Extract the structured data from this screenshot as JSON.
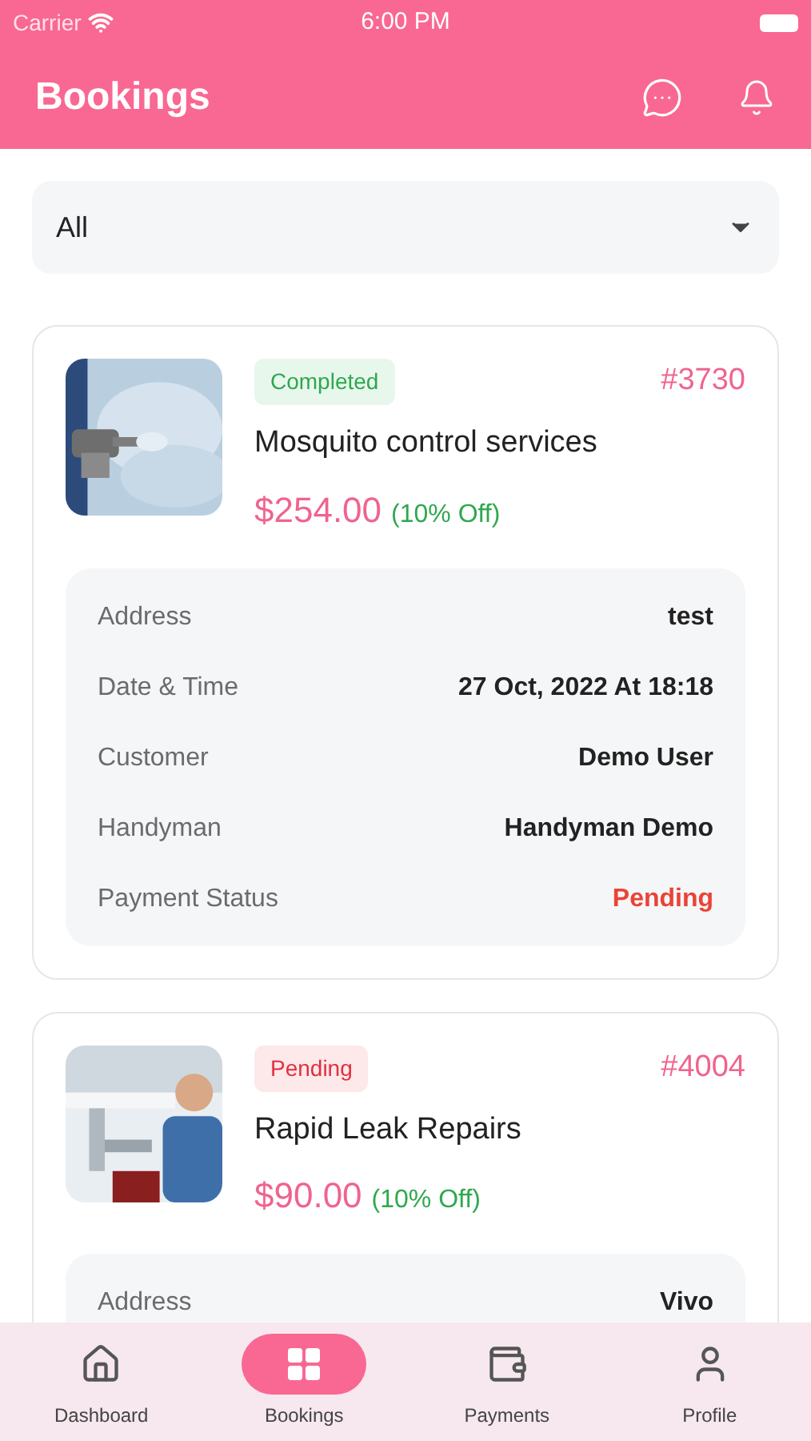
{
  "status_bar": {
    "carrier": "Carrier",
    "time": "6:00 PM"
  },
  "header": {
    "title": "Bookings"
  },
  "filter": {
    "value": "All"
  },
  "bookings": [
    {
      "status": "Completed",
      "kind": "completed",
      "number": "#3730",
      "title": "Mosquito control services",
      "price": "$254.00",
      "discount": "(10% Off)",
      "details": [
        {
          "label": "Address",
          "value": "test",
          "kind": "plain"
        },
        {
          "label": "Date & Time",
          "value": "27 Oct, 2022 At 18:18",
          "kind": "plain"
        },
        {
          "label": "Customer",
          "value": "Demo User",
          "kind": "plain"
        },
        {
          "label": "Handyman",
          "value": "Handyman Demo",
          "kind": "plain"
        },
        {
          "label": "Payment Status",
          "value": "Pending",
          "kind": "alert"
        }
      ]
    },
    {
      "status": "Pending",
      "kind": "pending",
      "number": "#4004",
      "title": "Rapid Leak Repairs",
      "price": "$90.00",
      "discount": "(10% Off)",
      "details": [
        {
          "label": "Address",
          "value": "Vivo",
          "kind": "plain"
        }
      ]
    }
  ],
  "nav": [
    {
      "label": "Dashboard",
      "kind": "home",
      "selected": false
    },
    {
      "label": "Bookings",
      "kind": "bookings",
      "selected": true
    },
    {
      "label": "Payments",
      "kind": "wallet",
      "selected": false
    },
    {
      "label": "Profile",
      "kind": "user",
      "selected": false
    }
  ]
}
